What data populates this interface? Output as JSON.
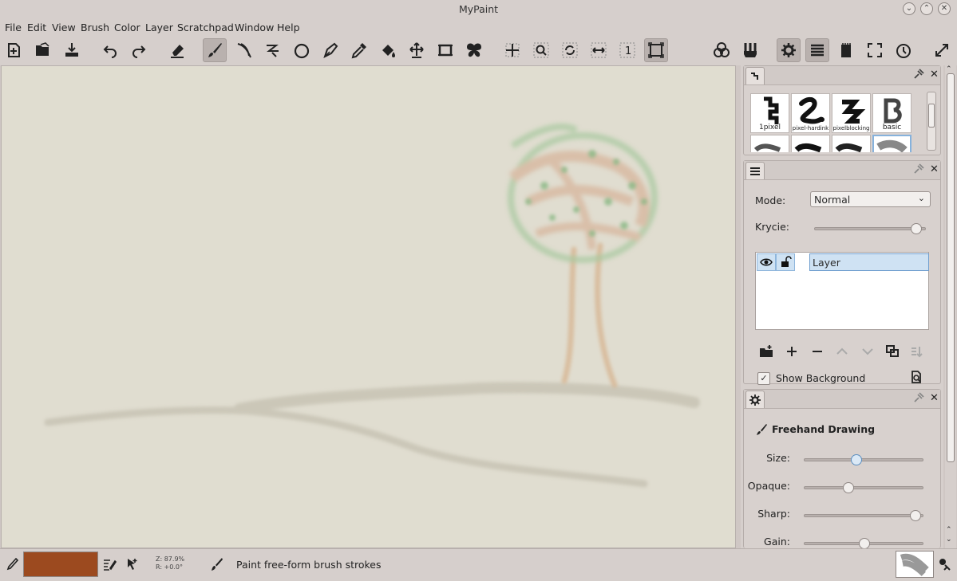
{
  "window": {
    "title": "MyPaint"
  },
  "menu": [
    "File",
    "Edit",
    "View",
    "Brush",
    "Color",
    "Layer",
    "Scratchpad",
    "Window",
    "Help"
  ],
  "toolbar": {
    "tools": [
      {
        "name": "new-document-icon"
      },
      {
        "name": "open-file-icon"
      },
      {
        "name": "save-icon"
      },
      {
        "name": "undo-icon"
      },
      {
        "name": "redo-icon"
      },
      {
        "name": "eraser-icon"
      },
      {
        "name": "freehand-brush-icon",
        "active": true
      },
      {
        "name": "inking-icon"
      },
      {
        "name": "line-icon"
      },
      {
        "name": "ellipse-icon"
      },
      {
        "name": "pen-icon"
      },
      {
        "name": "color-picker-icon"
      },
      {
        "name": "fill-bucket-icon"
      },
      {
        "name": "move-layer-icon"
      },
      {
        "name": "frame-icon"
      },
      {
        "name": "symmetry-icon"
      },
      {
        "name": "pan-view-icon"
      },
      {
        "name": "zoom-view-icon"
      },
      {
        "name": "rotate-view-icon"
      },
      {
        "name": "mirror-view-icon"
      },
      {
        "name": "reset-zoom-icon"
      },
      {
        "name": "fit-view-icon",
        "active": true
      },
      {
        "name": "color-wheel-icon"
      },
      {
        "name": "brushes-icon"
      },
      {
        "name": "settings-icon",
        "active": true
      },
      {
        "name": "layers-icon",
        "active": true
      },
      {
        "name": "scratchpad-icon"
      },
      {
        "name": "fullscreen-icon"
      },
      {
        "name": "history-icon"
      },
      {
        "name": "expand-icon"
      }
    ]
  },
  "brushes": {
    "items": [
      {
        "label": "1pixel"
      },
      {
        "label": "pixel-hardink"
      },
      {
        "label": "pixelblocking"
      },
      {
        "label": "basic"
      }
    ]
  },
  "layers": {
    "mode_label": "Mode:",
    "mode_value": "Normal",
    "opacity_label": "Krycie:",
    "opacity_value": 0.95,
    "layer_name": "Layer",
    "show_background_label": "Show Background",
    "show_background_checked": "✓"
  },
  "tool_options": {
    "title": "Freehand Drawing",
    "size_label": "Size:",
    "size_value": 0.43,
    "opaque_label": "Opaque:",
    "opaque_value": 0.35,
    "sharp_label": "Sharp:",
    "sharp_value": 0.97,
    "gain_label": "Gain:",
    "gain_value": 0.5
  },
  "status": {
    "zoom_line": "Z: 87.9%",
    "rotation_line": "R: +0.0°",
    "message": "Paint free-form brush strokes",
    "current_color": "#9c4a1f"
  },
  "colors": {
    "canvas_bg": "#e0ddd0",
    "accent": "#86b2dc"
  }
}
